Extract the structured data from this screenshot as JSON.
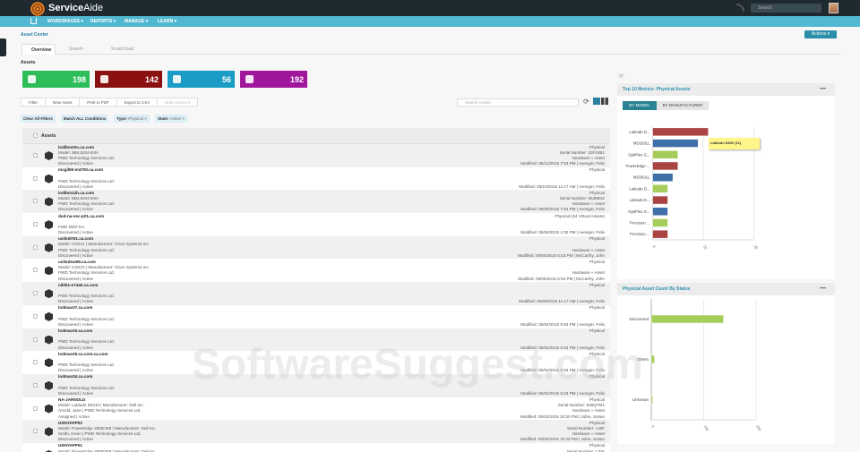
{
  "header": {
    "brand_bold": "Service",
    "brand_light": "Aide",
    "search_placeholder": "Search"
  },
  "nav": [
    "WORKSPACES ▾",
    "REPORTS ▾",
    "MANAGE ▾",
    "LEARN ▾"
  ],
  "breadcrumb": "Asset Center",
  "actions_label": "Actions ▾",
  "tabs": [
    "Overview",
    "Search",
    "Scratchpad"
  ],
  "assets_heading": "Assets",
  "tiles": [
    {
      "count": "198",
      "color": "#2dbe5a"
    },
    {
      "count": "142",
      "color": "#8b1010"
    },
    {
      "count": "56",
      "color": "#1a9cc4"
    },
    {
      "count": "192",
      "color": "#a0179c"
    }
  ],
  "toolbar": [
    "Filter",
    "New Asset",
    "Print to PDF",
    "Export to CSV",
    "Bulk Actions ▾"
  ],
  "chips": {
    "clear": "Clear All Filters",
    "match": "Match ALL Conditions",
    "type_label": "Type:",
    "type_value": "Physical ×",
    "state_label": "State:",
    "state_value": "Active ×"
  },
  "asset_search_placeholder": "Search Assets",
  "table_header": "Assets",
  "rows": [
    {
      "name": "lodibm20o.ca.com",
      "l2": "Model: IBM,8204-E8A",
      "l3": "PWD Technology Services Ltd.",
      "l4": "Discovered | Active",
      "r1": "Physical",
      "r2": "Serial Number: 10F24B1",
      "r3": "Hardware » Asset",
      "r4": "Modified: 05/12/2015 7:53 PM | Avenger, Felix"
    },
    {
      "name": "mcgil05-m4700.ca.com",
      "l2": "",
      "l3": "PWD Technology Services Ltd.",
      "l4": "Discovered | Active",
      "r1": "Physical",
      "r2": "",
      "r3": "",
      "r4": "Modified: 05/10/2015 11:17 AM | Avenger, Felix"
    },
    {
      "name": "lodibm12h.ca.com",
      "l2": "Model: IBM,8204-E8A",
      "l3": "PWD Technology Services Ltd.",
      "l4": "Discovered | Active",
      "r1": "Physical",
      "r2": "Serial Number: 0638B42",
      "r3": "Hardware » Asset",
      "r4": "Modified: 05/09/2015 7:54 PM | Avenger, Felix"
    },
    {
      "name": "dod-na-vec-p01.ca.com",
      "l2": "",
      "l3": "FWD MSP Inc.",
      "l4": "Discovered | Active",
      "r1": "Physical (34 Virtual Assets)",
      "r2": "",
      "r3": "",
      "r4": "Modified: 05/08/2015 4:30 PM | Avenger, Felix"
    },
    {
      "name": "usilodrt01.ca.com",
      "l2": "Model: CISCO | Manufacturer: Cisco Systems Inc.",
      "l3": "PWD Technology Services Ltd.",
      "l4": "Discovered | Active",
      "r1": "Physical",
      "r2": "",
      "r3": "Hardware » Asset",
      "r4": "Modified: 05/06/2015 5:53 PM | McCarthy, John"
    },
    {
      "name": "usilodsw08.ca.com",
      "l2": "Model: CISCO | Manufacturer: Cisco Systems Inc.",
      "l3": "PWD Technology Services Ltd.",
      "l4": "Discovered | Active",
      "r1": "Physical",
      "r2": "",
      "r3": "Hardware » Asset",
      "r4": "Modified: 05/06/2015 5:53 PM | McCarthy, John"
    },
    {
      "name": "nikl01-e7440.ca.com",
      "l2": "",
      "l3": "PWD Technology Services Ltd.",
      "l4": "Discovered | Active",
      "r1": "Physical",
      "r2": "",
      "r3": "",
      "r4": "Modified: 05/06/2015 11:17 AM | Avenger, Felix"
    },
    {
      "name": "lodmac07.ca.com",
      "l2": "",
      "l3": "PWD Technology Services Ltd.",
      "l4": "Discovered | Active",
      "r1": "Physical",
      "r2": "",
      "r3": "",
      "r4": "Modified: 05/04/2015 5:53 PM | Avenger, Felix"
    },
    {
      "name": "lodmac03.ca.com",
      "l2": "",
      "l3": "PWD Technology Services Ltd.",
      "l4": "Discovered | Active",
      "r1": "Physical",
      "r2": "",
      "r3": "",
      "r4": "Modified: 05/04/2015 5:53 PM | Avenger, Felix"
    },
    {
      "name": "lodmac05.ca.com.ca.com",
      "l2": "",
      "l3": "PWD Technology Services Ltd.",
      "l4": "Discovered | Active",
      "r1": "Physical",
      "r2": "",
      "r3": "",
      "r4": "Modified: 05/04/2015 5:53 PM | Avenger, Felix"
    },
    {
      "name": "lodmac04.ca.com",
      "l2": "",
      "l3": "PWD Technology Services Ltd.",
      "l4": "Discovered | Active",
      "r1": "Physical",
      "r2": "",
      "r3": "",
      "r4": "Modified: 05/04/2015 5:53 PM | Avenger, Felix"
    },
    {
      "name": "NA-JARNOLD",
      "l2": "Model: Latitude E6410 | Manufacturer: Dell Inc.",
      "l3": "Arnold, Jane | PWD Technology Services Ltd.",
      "l4": "Assigned | Active",
      "r1": "Physical",
      "r2": "Serial Number: 548QTM1",
      "r3": "Hardware » Asset",
      "r4": "Modified: 05/02/2015 10:30 PM | Jobin, Susan"
    },
    {
      "name": "USNYAPP02",
      "l2": "Model: PowerEdge 2800/458 | Manufacturer: Dell Inc.",
      "l3": "Smith, Kevin | PWD Technology Services Ltd.",
      "l4": "Discovered | Active",
      "r1": "Physical",
      "r2": "Serial Number: 1J0F",
      "r3": "Hardware » Asset",
      "r4": "Modified: 05/02/2015 10:30 PM | Jobin, Susan"
    },
    {
      "name": "USNYAPP01",
      "l2": "Model: PowerEdge 2800/458 | Manufacturer: Dell Inc.",
      "l3": "",
      "l4": "",
      "r1": "Physical",
      "r2": "Serial Number: 1J0X",
      "r3": "",
      "r4": ""
    }
  ],
  "panel1": {
    "title": "Top 10 Metrics: Physical Assets",
    "by_model": "BY MODEL",
    "by_manufacturer": "BY MANUFACTURER",
    "tooltip": "Latitude D820 (11)"
  },
  "panel2": {
    "title": "Physical Asset Count By Status"
  },
  "watermark": "SoftwareSuggest.com",
  "chart_data": [
    {
      "type": "bar",
      "orientation": "horizontal",
      "title": "Top 10 Metrics: Physical Assets",
      "categories": [
        "Latitude D...",
        "MD328LL",
        "OptiPlex G...",
        "PowerEdge ...",
        "MD363LL",
        "Latitude D...",
        "Latitude E...",
        "OptiPlex G...",
        "Precision ...",
        "Precision ..."
      ],
      "values": [
        11,
        9,
        5,
        5,
        4,
        3,
        3,
        3,
        3,
        3
      ],
      "colors": [
        "#a94442",
        "#3f6fa8",
        "#a6cc5a",
        "#a94442",
        "#3f6fa8",
        "#a6cc5a",
        "#a94442",
        "#3f6fa8",
        "#a6cc5a",
        "#a94442"
      ],
      "xlim": [
        0,
        20
      ],
      "xticks": [
        "0",
        "10",
        "20"
      ],
      "grid": true
    },
    {
      "type": "bar",
      "orientation": "horizontal",
      "title": "Physical Asset Count By Status",
      "categories": [
        "Discovered",
        "Others",
        "Unknown"
      ],
      "values": [
        138,
        6,
        3
      ],
      "colors": [
        "#a6cc5a",
        "#a6cc5a",
        "#a6cc5a"
      ],
      "xlim": [
        0,
        200
      ],
      "xticks": [
        "0",
        "100",
        "200"
      ],
      "grid": true
    }
  ]
}
